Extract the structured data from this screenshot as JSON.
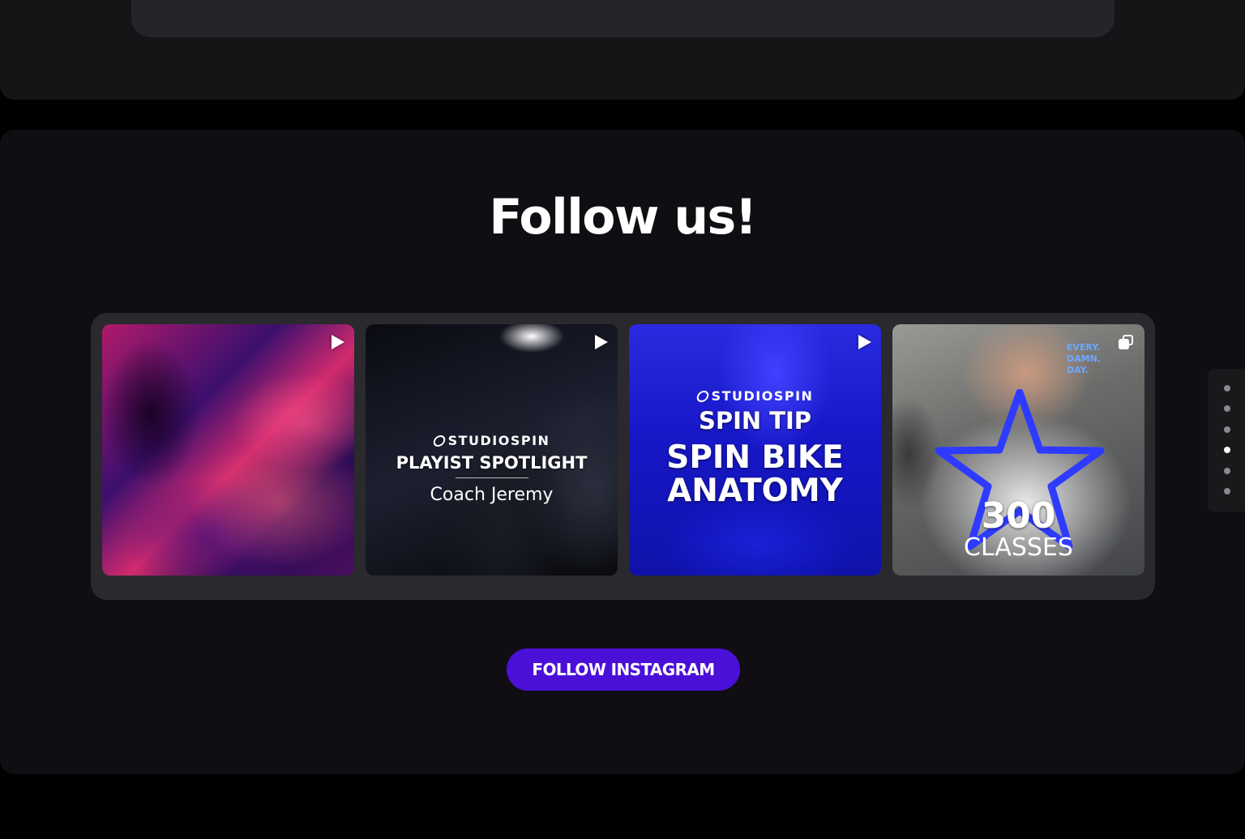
{
  "follow": {
    "title": "Follow us!",
    "button_label": "FOLLOW INSTAGRAM"
  },
  "instagram_feed": {
    "posts": [
      {
        "type": "video",
        "brand": "",
        "heading": "",
        "subheading": ""
      },
      {
        "type": "video",
        "brand": "STUDIOSPIN",
        "heading": "PLAYIST SPOTLIGHT",
        "subheading": "Coach Jeremy"
      },
      {
        "type": "video",
        "brand": "STUDIOSPIN",
        "heading": "SPIN TIP",
        "subheading": "SPIN BIKE ANATOMY"
      },
      {
        "type": "carousel",
        "brand": "",
        "heading": "300",
        "subheading": "CLASSES",
        "sign_text": "EVERY. DAMN. DAY."
      }
    ]
  },
  "page_nav": {
    "dots": 6,
    "active_index": 3
  },
  "colors": {
    "accent": "#4a10d8",
    "section_bg": "#100e12",
    "feed_bg": "#2a292d"
  }
}
